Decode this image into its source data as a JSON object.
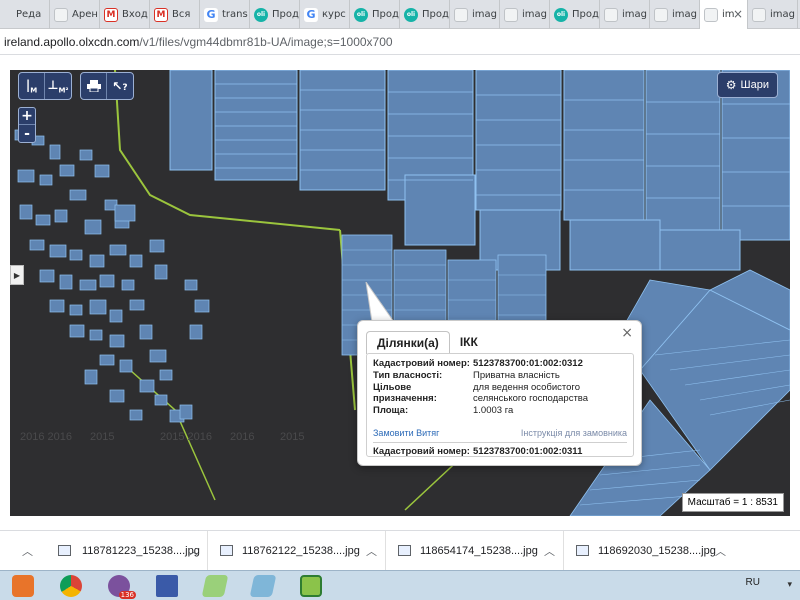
{
  "browser": {
    "tabs": [
      {
        "label": "Реда",
        "icon": "blank"
      },
      {
        "label": "Арен",
        "icon": "doc"
      },
      {
        "label": "Вход",
        "icon": "gmail"
      },
      {
        "label": "Вся",
        "icon": "gmail"
      },
      {
        "label": "trans",
        "icon": "google"
      },
      {
        "label": "Прод",
        "icon": "olx"
      },
      {
        "label": "курс",
        "icon": "google"
      },
      {
        "label": "Прод",
        "icon": "olx"
      },
      {
        "label": "Прод",
        "icon": "olx"
      },
      {
        "label": "imag",
        "icon": "doc"
      },
      {
        "label": "imag",
        "icon": "doc"
      },
      {
        "label": "Прод",
        "icon": "olx"
      },
      {
        "label": "imag",
        "icon": "doc"
      },
      {
        "label": "imag",
        "icon": "doc"
      },
      {
        "label": "im",
        "icon": "doc",
        "active": true
      },
      {
        "label": "imag",
        "icon": "doc"
      }
    ],
    "url_host": "ireland.apollo.olxcdn.com",
    "url_path": "/v1/files/vgm44dbmr81b-UA/image;s=1000x700"
  },
  "map": {
    "controls": {
      "ruler_label": "М",
      "area_label": "М²",
      "print_icon": "printer-icon",
      "help_label": "?",
      "zoom_in": "+",
      "zoom_out": "-",
      "layers_label": "Шари"
    },
    "scale_text": "Масштаб = 1 : 8531",
    "popup": {
      "tab_active": "Ділянки(а)",
      "tab_other": "ІКК",
      "close": "×",
      "rows": [
        {
          "key": "Кадастровий номер:",
          "value": "5123783700:01:002:0312",
          "bold": true
        },
        {
          "key": "Тип власності:",
          "value": "Приватна власність"
        },
        {
          "key": "Цільове призначення:",
          "value": "для ведення особистого селянського господарства"
        },
        {
          "key": "Площа:",
          "value": "1.0003 га"
        }
      ],
      "order_link": "Замовити Витяг",
      "instruction_link": "Інструкція для замовника",
      "next_key": "Кадастровий номер:",
      "next_value": "5123783700:01:002:0311"
    }
  },
  "downloads": [
    {
      "name": "118781223_15238....jpg"
    },
    {
      "name": "118762122_15238....jpg"
    },
    {
      "name": "118654174_15238....jpg"
    },
    {
      "name": "118692030_15238....jpg"
    }
  ],
  "taskbar": {
    "language": "RU",
    "apps": [
      "media-player-icon",
      "chrome-icon",
      "viber-icon",
      "save-icon",
      "notepad-icon",
      "editor-icon",
      "chart-app-icon"
    ],
    "viber_badge": "136"
  }
}
